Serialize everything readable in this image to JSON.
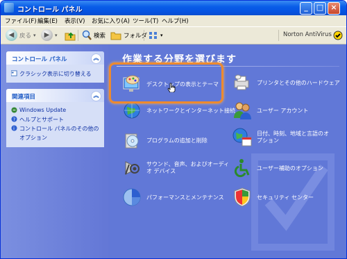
{
  "window": {
    "title": "コントロール パネル"
  },
  "menu": [
    "ファイル(F)",
    "編集(E)",
    "表示(V)",
    "お気に入り(A)",
    "ツール(T)",
    "ヘルプ(H)"
  ],
  "toolbar": {
    "back": "戻る",
    "search": "検索",
    "folders": "フォルダ",
    "norton": "Norton AntiVirus"
  },
  "left": {
    "panel1": {
      "title": "コントロール パネル",
      "link": "クラシック表示に切り替える"
    },
    "panel2": {
      "title": "関連項目",
      "items": [
        "Windows Update",
        "ヘルプとサポート",
        "コントロール パネルのその他の",
        "オプション"
      ]
    }
  },
  "main": {
    "heading": "作業する分野を選びます",
    "categories": [
      "デスクトップの表示とテーマ",
      "プリンタとその他のハードウェア",
      "ネットワークとインターネット接続",
      "ユーザー アカウント",
      "プログラムの追加と削除",
      "日付、時刻、地域と言語のオ",
      "プション",
      "サウンド、音声、およびオーディ",
      "オ デバイス",
      "ユーザー補助のオプション",
      "パフォーマンスとメンテナンス",
      "セキュリティ センター"
    ]
  },
  "colors": {
    "xp_blue": "#0554e3",
    "pane_bg": "#6178d7",
    "highlight": "#ee8a2e"
  }
}
